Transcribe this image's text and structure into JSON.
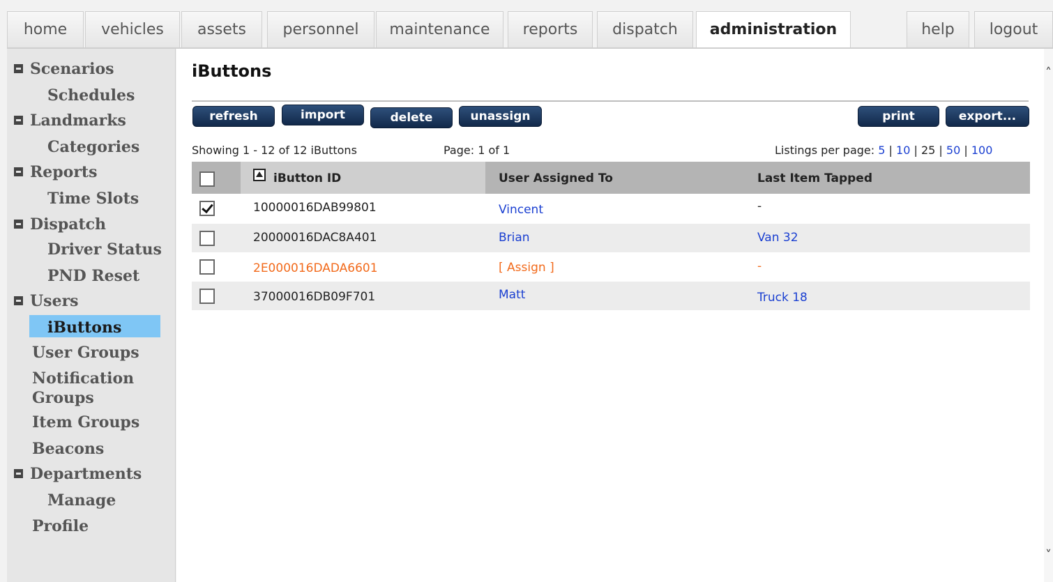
{
  "nav": {
    "tabs": [
      {
        "label": "home"
      },
      {
        "label": "vehicles"
      },
      {
        "label": "assets"
      },
      {
        "label": "personnel"
      },
      {
        "label": "maintenance"
      },
      {
        "label": "reports"
      },
      {
        "label": "dispatch"
      },
      {
        "label": "administration",
        "active": true
      },
      {
        "label": "help"
      },
      {
        "label": "logout"
      }
    ]
  },
  "sidebar": {
    "items": [
      {
        "label": "Scenarios",
        "group": true
      },
      {
        "label": "Schedules"
      },
      {
        "label": "Landmarks",
        "group": true
      },
      {
        "label": "Categories"
      },
      {
        "label": "Reports",
        "group": true
      },
      {
        "label": "Time Slots"
      },
      {
        "label": "Dispatch",
        "group": true
      },
      {
        "label": "Driver Status"
      },
      {
        "label": "PND Reset"
      },
      {
        "label": "Users",
        "group": true
      },
      {
        "label": "iButtons",
        "active": true
      },
      {
        "label": "User Groups"
      },
      {
        "label": "Notification"
      },
      {
        "label": "Groups"
      },
      {
        "label": "Item Groups"
      },
      {
        "label": "Beacons"
      },
      {
        "label": "Departments",
        "group": true
      },
      {
        "label": "Manage"
      },
      {
        "label": "Profile"
      }
    ]
  },
  "page": {
    "title": "iButtons"
  },
  "toolbar": {
    "refresh": "refresh",
    "import": "import",
    "delete": "delete",
    "unassign": "unassign",
    "print": "print",
    "export": "export..."
  },
  "listing": {
    "showing": "Showing 1 - 12 of 12 iButtons",
    "page": "Page: 1 of 1",
    "per_page_label": "Listings per page:",
    "per_page_options": [
      "5",
      "10",
      "25",
      "50",
      "100"
    ]
  },
  "table": {
    "headers": {
      "id": "iButton ID",
      "user": "User Assigned To",
      "last": "Last Item Tapped"
    },
    "rows": [
      {
        "checked": true,
        "id": "10000016DAB99801",
        "user": "Vincent",
        "last": "-"
      },
      {
        "checked": false,
        "id": "20000016DAC8A401",
        "user": "Brian",
        "last": "Van 32"
      },
      {
        "checked": false,
        "id": "2E000016DADA6601",
        "user": "[ Assign ]",
        "last": "-",
        "unassigned": true
      },
      {
        "checked": false,
        "id": "37000016DB09F701",
        "user": "Matt",
        "last": "Truck 18"
      }
    ]
  }
}
